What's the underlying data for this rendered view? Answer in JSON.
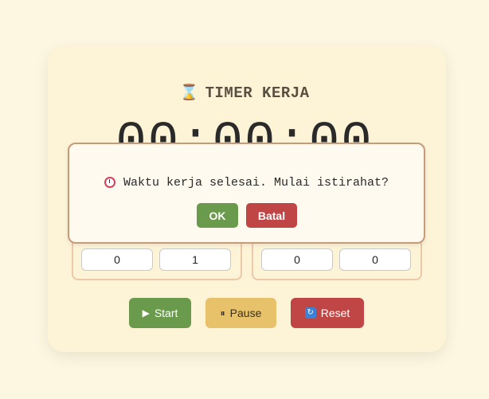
{
  "app": {
    "title": "TIMER KERJA",
    "title_icon": "hourglass-icon"
  },
  "timer": {
    "display": "00:00:00"
  },
  "settings": {
    "work": {
      "minutes": "0",
      "seconds": "1"
    },
    "rest": {
      "minutes": "0",
      "seconds": "0"
    }
  },
  "controls": {
    "start_label": "Start",
    "start_icon": "play-icon",
    "pause_label": "Pause",
    "pause_icon": "pause-icon",
    "reset_label": "Reset",
    "reset_icon": "refresh-icon"
  },
  "dialog": {
    "message": "Waktu kerja selesai. Mulai istirahat?",
    "icon": "alarm-clock-icon",
    "ok_label": "OK",
    "cancel_label": "Batal"
  },
  "colors": {
    "page_bg": "#fdf6e0",
    "card_bg": "#fdf3d7",
    "start": "#6a9a4b",
    "pause": "#e8c26a",
    "reset": "#c04646",
    "dialog_border": "#c79b7a"
  }
}
